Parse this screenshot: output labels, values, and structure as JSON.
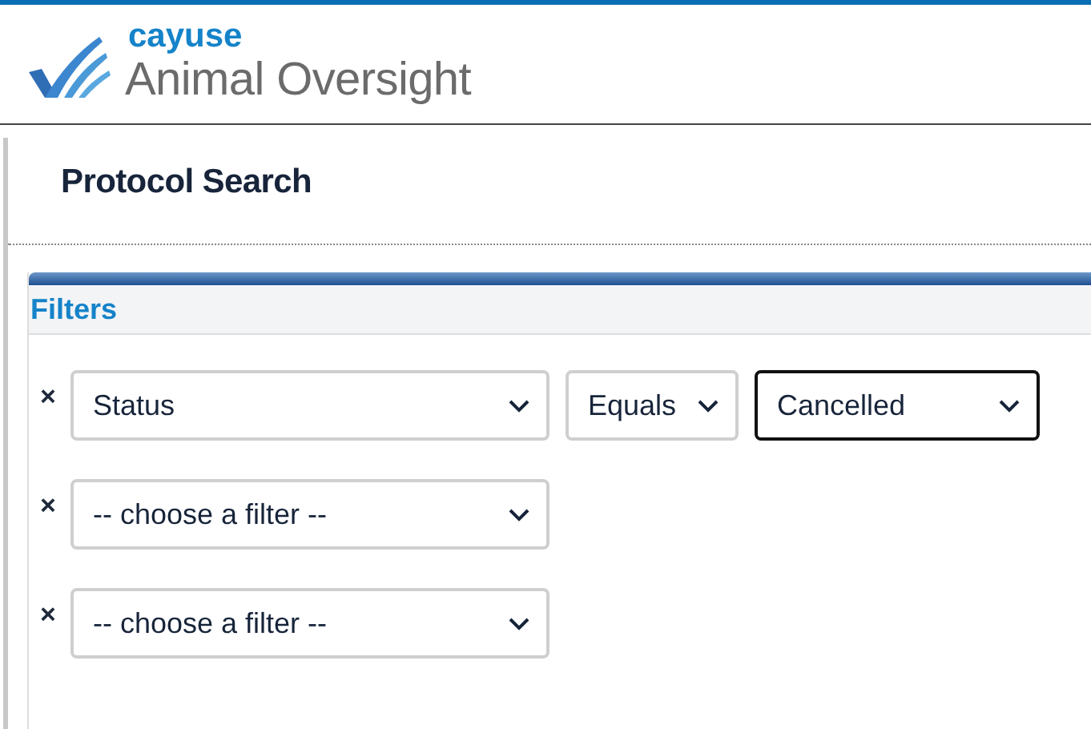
{
  "brand": {
    "company": "cayuse",
    "product": "Animal Oversight"
  },
  "page": {
    "title": "Protocol Search"
  },
  "filters": {
    "title": "Filters",
    "rows": [
      {
        "remove": "×",
        "selects": [
          {
            "value": "Status",
            "focused": false
          },
          {
            "value": "Equals",
            "focused": false
          },
          {
            "value": "Cancelled",
            "focused": true
          }
        ]
      },
      {
        "remove": "×",
        "selects": [
          {
            "value": "-- choose a filter --",
            "focused": false
          }
        ]
      },
      {
        "remove": "×",
        "selects": [
          {
            "value": "-- choose a filter --",
            "focused": false
          }
        ]
      }
    ]
  }
}
